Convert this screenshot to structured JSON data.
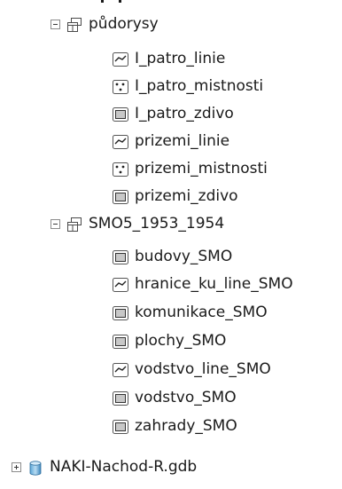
{
  "tree": {
    "groups": [
      {
        "label": "půdorysy",
        "layers": [
          {
            "label": "I_patro_linie",
            "type": "line"
          },
          {
            "label": "I_patro_mistnosti",
            "type": "point"
          },
          {
            "label": "I_patro_zdivo",
            "type": "polygon"
          },
          {
            "label": "prizemi_linie",
            "type": "line"
          },
          {
            "label": "prizemi_mistnosti",
            "type": "point"
          },
          {
            "label": "prizemi_zdivo",
            "type": "polygon"
          }
        ]
      },
      {
        "label": "SMO5_1953_1954",
        "layers": [
          {
            "label": "budovy_SMO",
            "type": "polygon"
          },
          {
            "label": "hranice_ku_line_SMO",
            "type": "line"
          },
          {
            "label": "komunikace_SMO",
            "type": "polygon"
          },
          {
            "label": "plochy_SMO",
            "type": "polygon"
          },
          {
            "label": "vodstvo_line_SMO",
            "type": "line"
          },
          {
            "label": "vodstvo_SMO",
            "type": "polygon"
          },
          {
            "label": "zahrady_SMO",
            "type": "polygon"
          }
        ]
      }
    ],
    "database": {
      "label": "NAKI-Nachod-R.gdb"
    }
  }
}
